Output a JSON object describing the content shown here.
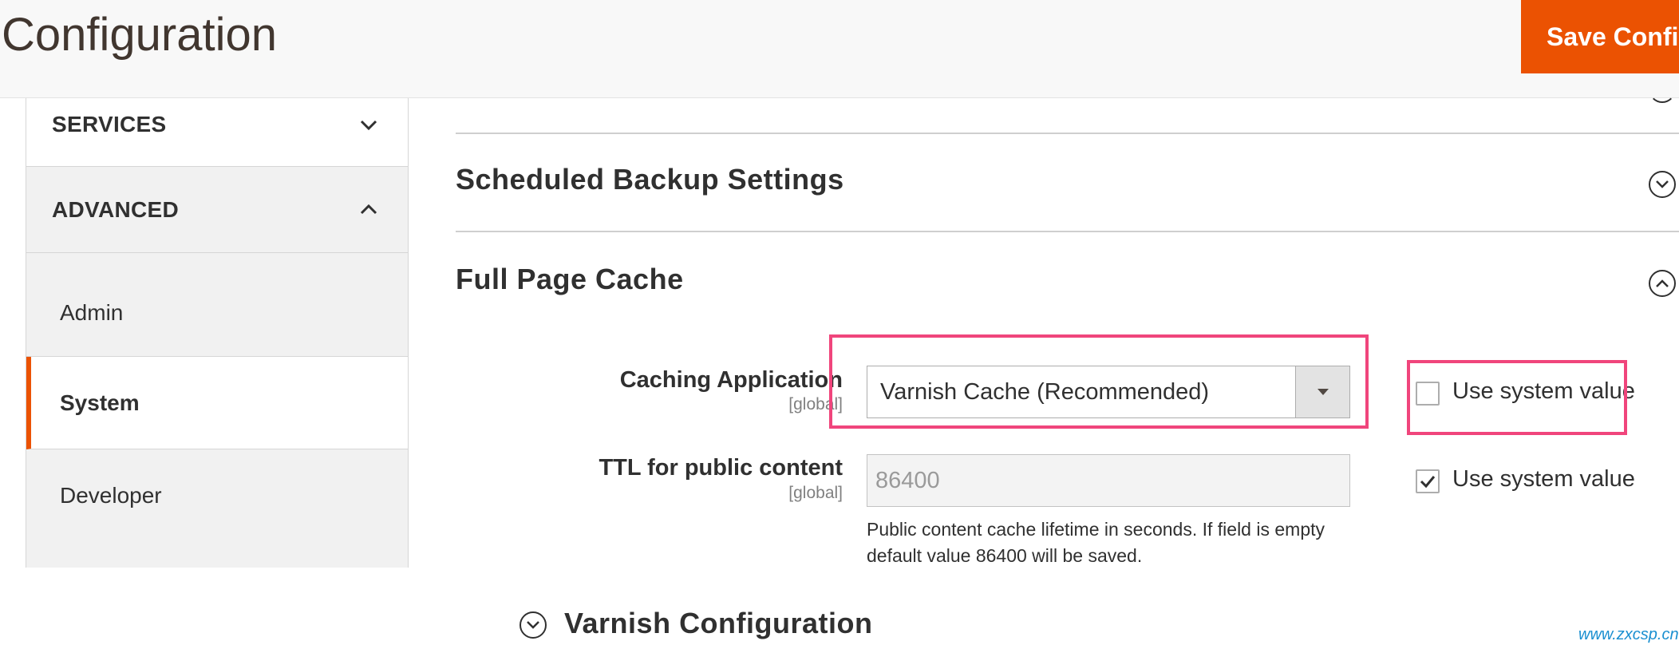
{
  "header": {
    "title": "Configuration",
    "save_button": "Save Confi"
  },
  "sidebar": {
    "groups": [
      {
        "label": "SERVICES",
        "state": "collapsed"
      },
      {
        "label": "ADVANCED",
        "state": "expanded"
      }
    ],
    "items": [
      {
        "label": "Admin"
      },
      {
        "label": "System",
        "active": true
      },
      {
        "label": "Developer"
      }
    ]
  },
  "main": {
    "sections": [
      {
        "title": "Scheduled Backup Settings",
        "state": "collapsed"
      },
      {
        "title": "Full Page Cache",
        "state": "expanded"
      }
    ],
    "fields": {
      "caching_application": {
        "label": "Caching Application",
        "scope": "[global]",
        "value": "Varnish Cache (Recommended)",
        "use_system_value_label": "Use system value",
        "use_system_value_checked": false
      },
      "ttl": {
        "label": "TTL for public content",
        "scope": "[global]",
        "value": "86400",
        "note": "Public content cache lifetime in seconds. If field is empty default value 86400 will be saved.",
        "use_system_value_label": "Use system value",
        "use_system_value_checked": true
      }
    },
    "subsection": {
      "title": "Varnish Configuration",
      "state": "collapsed"
    }
  },
  "colors": {
    "accent": "#eb5202",
    "highlight": "#f0457c",
    "watermark": "#1a8fd0"
  },
  "watermark": "www.zxcsp.cn"
}
